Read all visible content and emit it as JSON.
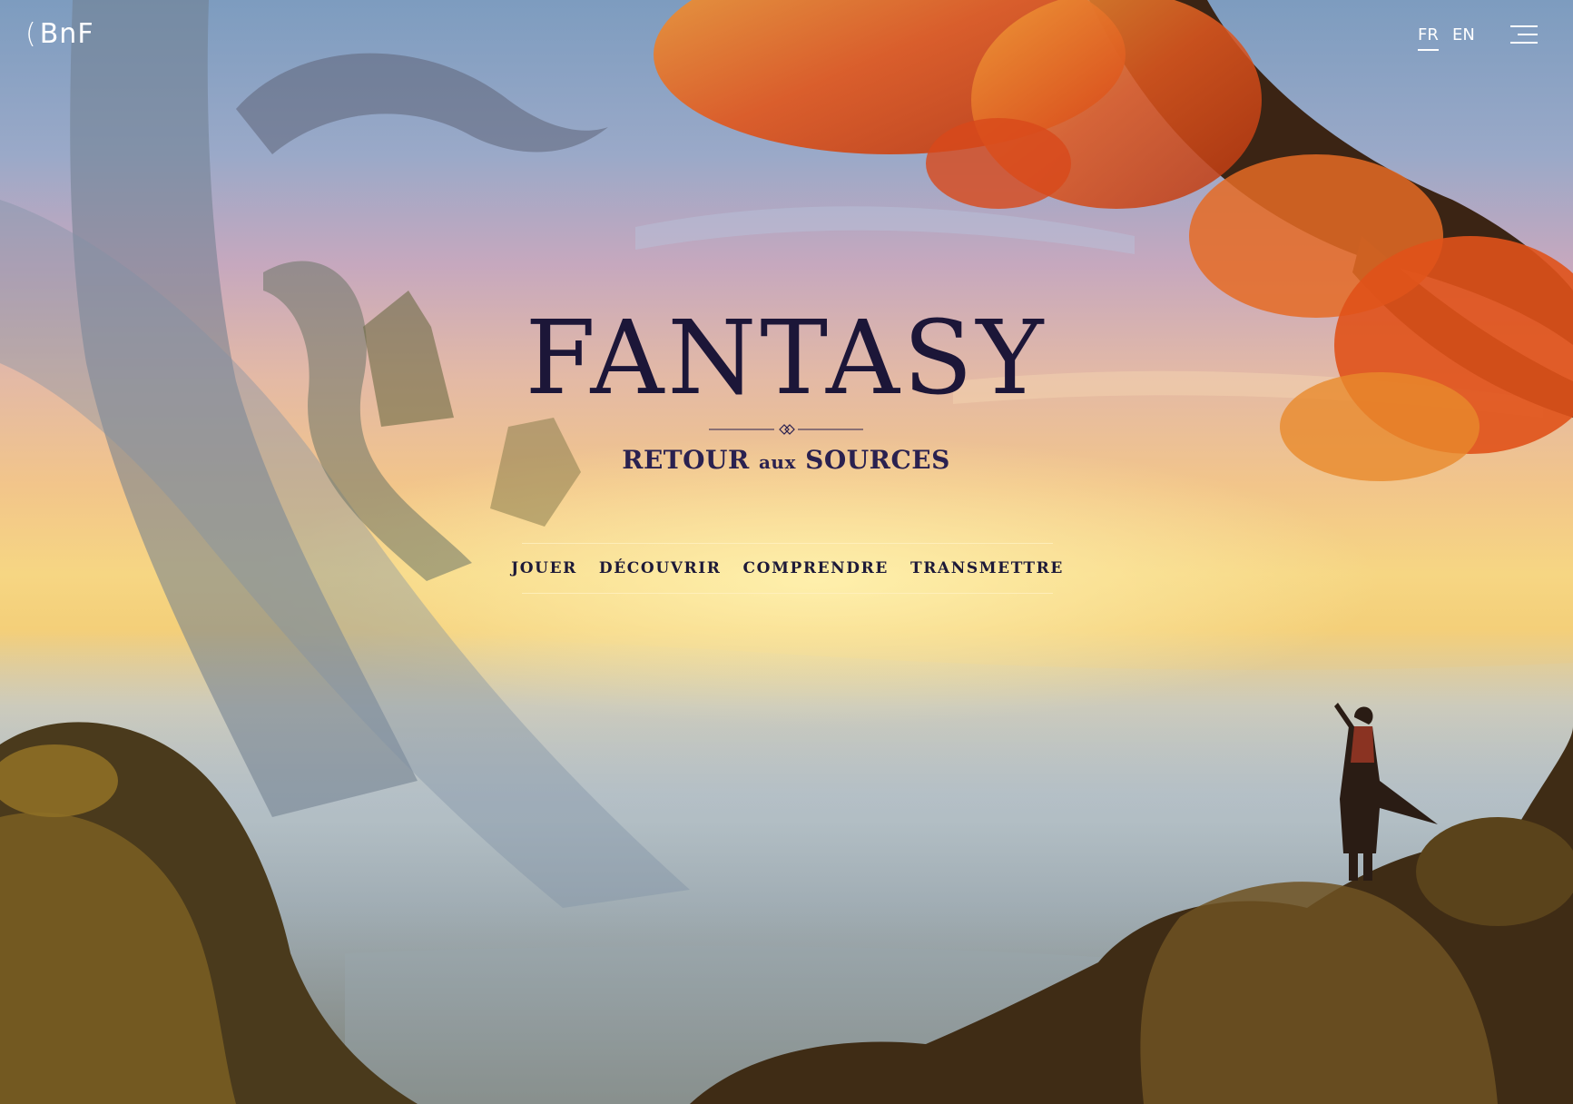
{
  "header": {
    "logo_text": "BnF",
    "logo_mark": "(",
    "languages": [
      {
        "code": "FR",
        "active": true
      },
      {
        "code": "EN",
        "active": false
      }
    ],
    "menu_icon": "hamburger-menu-icon"
  },
  "hero": {
    "title": "FANTASY",
    "ornament_icon": "diamond-divider-icon",
    "subtitle_part1": "RETOUR",
    "subtitle_part2": "aux",
    "subtitle_part3": "SOURCES"
  },
  "nav": {
    "items": [
      {
        "label": "JOUER"
      },
      {
        "label": "DÉCOUVRIR"
      },
      {
        "label": "COMPRENDRE"
      },
      {
        "label": "TRANSMETTRE"
      }
    ]
  },
  "colors": {
    "title": "#1c1638",
    "nav_text": "#1d1938",
    "header_text": "#ffffff",
    "nav_rule": "#fff0be"
  }
}
